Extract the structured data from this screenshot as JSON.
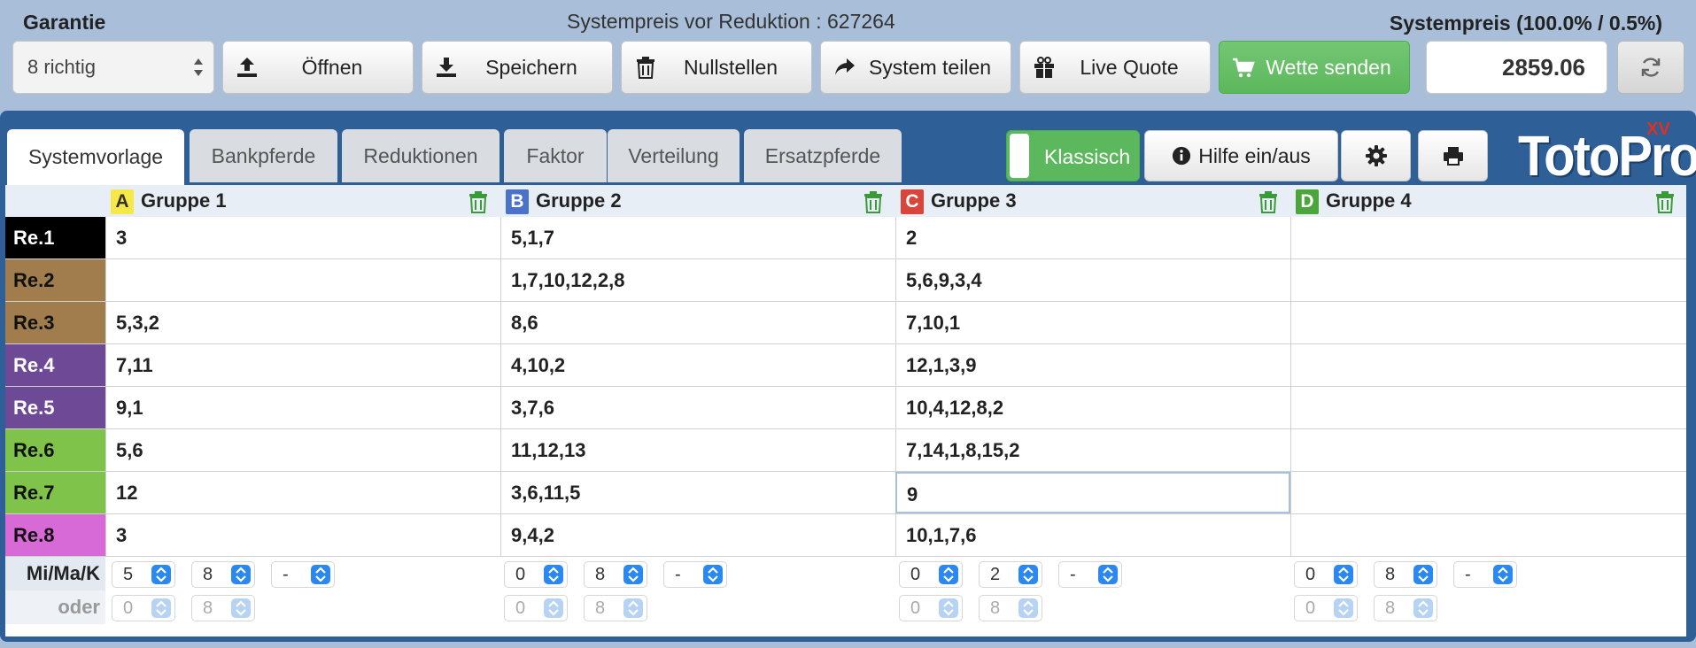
{
  "header": {
    "garantie_label": "Garantie",
    "price_before_text": "Systempreis vor Reduktion : 627264",
    "price_label": "Systempreis (100.0% / 0.5%)",
    "garantie_select_value": "8 richtig",
    "price_value": "2859.06"
  },
  "toolbar": {
    "open_label": "Öffnen",
    "save_label": "Speichern",
    "reset_label": "Nullstellen",
    "share_label": "System teilen",
    "live_quote_label": "Live Quote",
    "send_label": "Wette senden"
  },
  "tabs": [
    {
      "label": "Systemvorlage",
      "active": true
    },
    {
      "label": "Bankpferde",
      "active": false
    },
    {
      "label": "Reduktionen",
      "active": false
    },
    {
      "label": "Faktor",
      "active": false
    },
    {
      "label": "Verteilung",
      "active": false
    },
    {
      "label": "Ersatzpferde",
      "active": false
    }
  ],
  "panel": {
    "toggle_label": "Klassisch",
    "help_label": "Hilfe ein/aus",
    "logo_text": "TotoPro",
    "logo_sup": "XV"
  },
  "groups": [
    {
      "letter": "A",
      "name": "Gruppe 1",
      "badge_color": "#f7e84a",
      "badge_text_color": "#333333"
    },
    {
      "letter": "B",
      "name": "Gruppe 2",
      "badge_color": "#4a72c8",
      "badge_text_color": "#ffffff"
    },
    {
      "letter": "C",
      "name": "Gruppe 3",
      "badge_color": "#d9453b",
      "badge_text_color": "#ffffff"
    },
    {
      "letter": "D",
      "name": "Gruppe 4",
      "badge_color": "#4aa63a",
      "badge_text_color": "#ffffff"
    }
  ],
  "rows": [
    {
      "label": "Re.1",
      "color": "#000000",
      "text_color": "#ffffff",
      "cells": [
        "3",
        "5,1,7",
        "2",
        ""
      ]
    },
    {
      "label": "Re.2",
      "color": "#a17d4e",
      "text_color": "#111111",
      "cells": [
        "",
        "1,7,10,12,2,8",
        "5,6,9,3,4",
        ""
      ]
    },
    {
      "label": "Re.3",
      "color": "#a17d4e",
      "text_color": "#111111",
      "cells": [
        "5,3,2",
        "8,6",
        "7,10,1",
        ""
      ]
    },
    {
      "label": "Re.4",
      "color": "#6e4a96",
      "text_color": "#ffffff",
      "cells": [
        "7,11",
        "4,10,2",
        "12,1,3,9",
        ""
      ]
    },
    {
      "label": "Re.5",
      "color": "#6e4a96",
      "text_color": "#ffffff",
      "cells": [
        "9,1",
        "3,7,6",
        "10,4,12,8,2",
        ""
      ]
    },
    {
      "label": "Re.6",
      "color": "#7fc34a",
      "text_color": "#111111",
      "cells": [
        "5,6",
        "11,12,13",
        "7,14,1,8,15,2",
        ""
      ]
    },
    {
      "label": "Re.7",
      "color": "#7fc34a",
      "text_color": "#111111",
      "cells": [
        "12",
        "3,6,11,5",
        "9",
        ""
      ]
    },
    {
      "label": "Re.8",
      "color": "#d86ad8",
      "text_color": "#111111",
      "cells": [
        "3",
        "9,4,2",
        "10,1,7,6",
        ""
      ]
    }
  ],
  "minmax": {
    "label": "Mi/Ma/K",
    "or_label": "oder",
    "values": [
      {
        "min": "5",
        "max": "8",
        "k": "-"
      },
      {
        "min": "0",
        "max": "8",
        "k": "-"
      },
      {
        "min": "0",
        "max": "2",
        "k": "-"
      },
      {
        "min": "0",
        "max": "8",
        "k": "-"
      }
    ],
    "or_values": [
      {
        "min": "0",
        "max": "8"
      },
      {
        "min": "0",
        "max": "8"
      },
      {
        "min": "0",
        "max": "8"
      },
      {
        "min": "0",
        "max": "8"
      }
    ]
  },
  "colors": {
    "accent_green": "#5cb85c",
    "panel_blue": "#2f5f97",
    "page_bg": "#a9bfd9",
    "trash_green": "#3a9a3a",
    "spinner_blue": "#2b88f0"
  },
  "icons": {
    "upload": "upload-icon",
    "download": "download-icon",
    "trash": "trash-icon",
    "share": "share-icon",
    "gift": "gift-icon",
    "cart": "cart-icon",
    "refresh": "refresh-icon",
    "info": "info-icon",
    "gear": "gear-icon",
    "print": "print-icon"
  }
}
